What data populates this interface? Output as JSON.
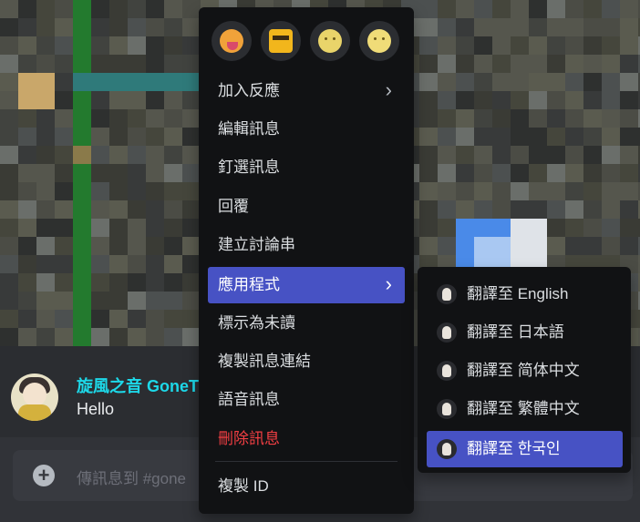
{
  "message": {
    "username": "旋風之音 GoneT",
    "text": "Hello"
  },
  "composer": {
    "placeholder": "傳訊息到 #gone",
    "plus_icon": "+"
  },
  "reactions": [
    {
      "icon": "tongue-face-emoji-icon"
    },
    {
      "icon": "sunglasses-block-emoji-icon"
    },
    {
      "icon": "smiling-face-emoji-icon"
    },
    {
      "icon": "neutral-face-emoji-icon"
    }
  ],
  "context_menu": {
    "items": [
      {
        "label": "加入反應",
        "submenu": true
      },
      {
        "label": "編輯訊息"
      },
      {
        "label": "釘選訊息"
      },
      {
        "label": "回覆"
      },
      {
        "label": "建立討論串"
      },
      {
        "label": "應用程式",
        "submenu": true,
        "active": true
      },
      {
        "label": "標示為未讀"
      },
      {
        "label": "複製訊息連結"
      },
      {
        "label": "語音訊息"
      },
      {
        "label": "刪除訊息",
        "danger": true
      },
      {
        "label": "複製 ID"
      }
    ],
    "chevron": "›"
  },
  "apps_submenu": {
    "items": [
      {
        "label": "翻譯至 English"
      },
      {
        "label": "翻譯至 日本語"
      },
      {
        "label": "翻譯至 简体中文"
      },
      {
        "label": "翻譯至 繁體中文"
      },
      {
        "label": "翻譯至 한국인",
        "active": true
      }
    ]
  },
  "colors": {
    "menu_bg": "#111214",
    "active_item": "#4752c4",
    "danger": "#f23f43",
    "username": "#1dd8e8"
  }
}
